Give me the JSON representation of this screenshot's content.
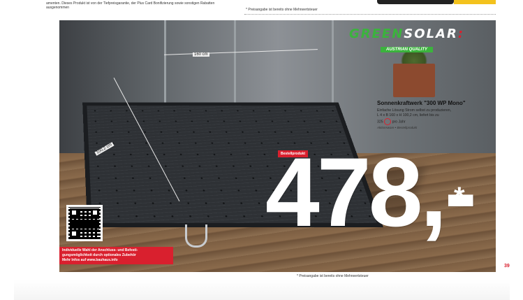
{
  "header": {
    "top_left_text": "amenten. Dieses Produkt ist von der Tiefpreisgarantie, der Plus Card Bonifizierung sowie sonstigen Rabatten ausgenommen",
    "top_right_text": "* Preisangabe ist bereits ohne Mehrwertsteuer"
  },
  "logo": {
    "green_part": "GREEN",
    "white_part": "SOLAR",
    "mark": ":",
    "tagline": "AUSTRIAN QUALITY"
  },
  "dimensions": {
    "width_label": "160 cm",
    "height_label": "100,2 cm"
  },
  "product": {
    "title": "Sonnenkraftwerk \"300 WP Mono\"",
    "desc_line1": "Einfache Lösung Strom selbst zu produzieren,",
    "desc_line2": "L 4 x B 160 x H 100,2 cm, liefert bis zu",
    "desc_kwh": "325",
    "desc_suffix": "pro Jahr",
    "note": "Aktionsware • Bestellprodukt"
  },
  "badge": {
    "label": "Bestellprodukt"
  },
  "price": {
    "value": "478",
    "suffix": ",-",
    "star": "*"
  },
  "info_box": {
    "line1": "Individuelle Wahl der Anschluss- und Befesti-",
    "line2": "gungsmöglichkeit durch optionales Zubehör",
    "line3": "Mehr Infos auf www.bauhaus.info"
  },
  "footer": {
    "footnote": "* Preisangabe ist bereits ohne Mehrwertsteuer",
    "page_number": "39"
  },
  "colors": {
    "brand_green": "#3bb33d",
    "brand_red": "#d9202e",
    "price_white": "#ffffff"
  }
}
